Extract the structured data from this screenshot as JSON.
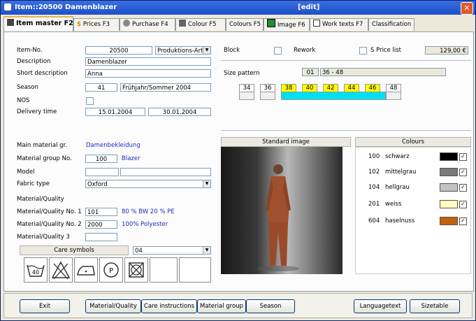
{
  "window": {
    "title": "Item::20500  Damenblazer",
    "mode": "[edit]"
  },
  "tabs": [
    {
      "label": "Item master F2",
      "icon": "item-master-icon"
    },
    {
      "label": "Prices F3",
      "icon": "dollar-icon"
    },
    {
      "label": "Purchase F4",
      "icon": "purchase-icon"
    },
    {
      "label": "Colour F5",
      "icon": "colour-icon"
    },
    {
      "label": "Colours F5",
      "icon": ""
    },
    {
      "label": "Image F6",
      "icon": "image-icon"
    },
    {
      "label": "Work texts F7",
      "icon": "document-icon"
    },
    {
      "label": "Classification",
      "icon": ""
    }
  ],
  "form": {
    "item_no_label": "Item-No.",
    "item_no": "20500",
    "item_type": "Produktions-Artil",
    "description_label": "Description",
    "description": "Damenblazer",
    "short_desc_label": "Short description",
    "short_desc": "Anna",
    "season_label": "Season",
    "season_code": "41",
    "season_name": "Frühjahr/Sommer 2004",
    "nos_label": "NOS",
    "delivery_label": "Delivery time",
    "delivery_from": "15.01.2004",
    "delivery_to": "30.01.2004",
    "main_material_label": "Main material gr.",
    "main_material": "Damenbekleidung",
    "material_group_label": "Material group No.",
    "material_group_no": "100",
    "material_group_name": "Blazer",
    "model_label": "Model",
    "model_code": "",
    "model_name": "",
    "fabric_label": "Fabric type",
    "fabric": "Oxford",
    "material_quality_label": "Material/Quality",
    "mq1_label": "Material/Quality No. 1",
    "mq1": "101",
    "mq1_desc": "80 % BW 20 % PE",
    "mq2_label": "Material/Quality No. 2",
    "mq2": "2000",
    "mq2_desc": "100% Polyester",
    "mq3_label": "Material/Quality 3",
    "mq3": "",
    "care_symbols_label": "Care symbols",
    "care_symbols_value": "04"
  },
  "right": {
    "block_label": "Block",
    "rework_label": "Rework",
    "sprice_label": "S Price list",
    "sprice": "129,00 €",
    "size_pattern_label": "Size pattern",
    "size_pattern_code": "01",
    "size_pattern_range": "36 - 48",
    "sizes": [
      "34",
      "36",
      "38",
      "40",
      "42",
      "44",
      "46",
      "48"
    ],
    "standard_image_label": "Standard image",
    "colours_label": "Colours",
    "colours": [
      {
        "code": "100",
        "name": "schwarz",
        "hex": "#000000"
      },
      {
        "code": "102",
        "name": "mittelgrau",
        "hex": "#7a7a7a"
      },
      {
        "code": "104",
        "name": "hellgrau",
        "hex": "#c2c2c2"
      },
      {
        "code": "201",
        "name": "weiss",
        "hex": "#ffffc0"
      },
      {
        "code": "604",
        "name": "haselnuss",
        "hex": "#c06010"
      }
    ]
  },
  "buttons": {
    "exit": "Exit",
    "material_quality": "Material/Quality",
    "care_instructions": "Care instructions",
    "material_group": "Material group",
    "season": "Season",
    "languagetext": "Languagetext",
    "sizetable": "Sizetable"
  },
  "colors": {
    "title_bar": "#2a5fd8",
    "size_active": "#ffff00",
    "size_sub": "#00e0f0",
    "link_blue": "#1a2bbd"
  }
}
